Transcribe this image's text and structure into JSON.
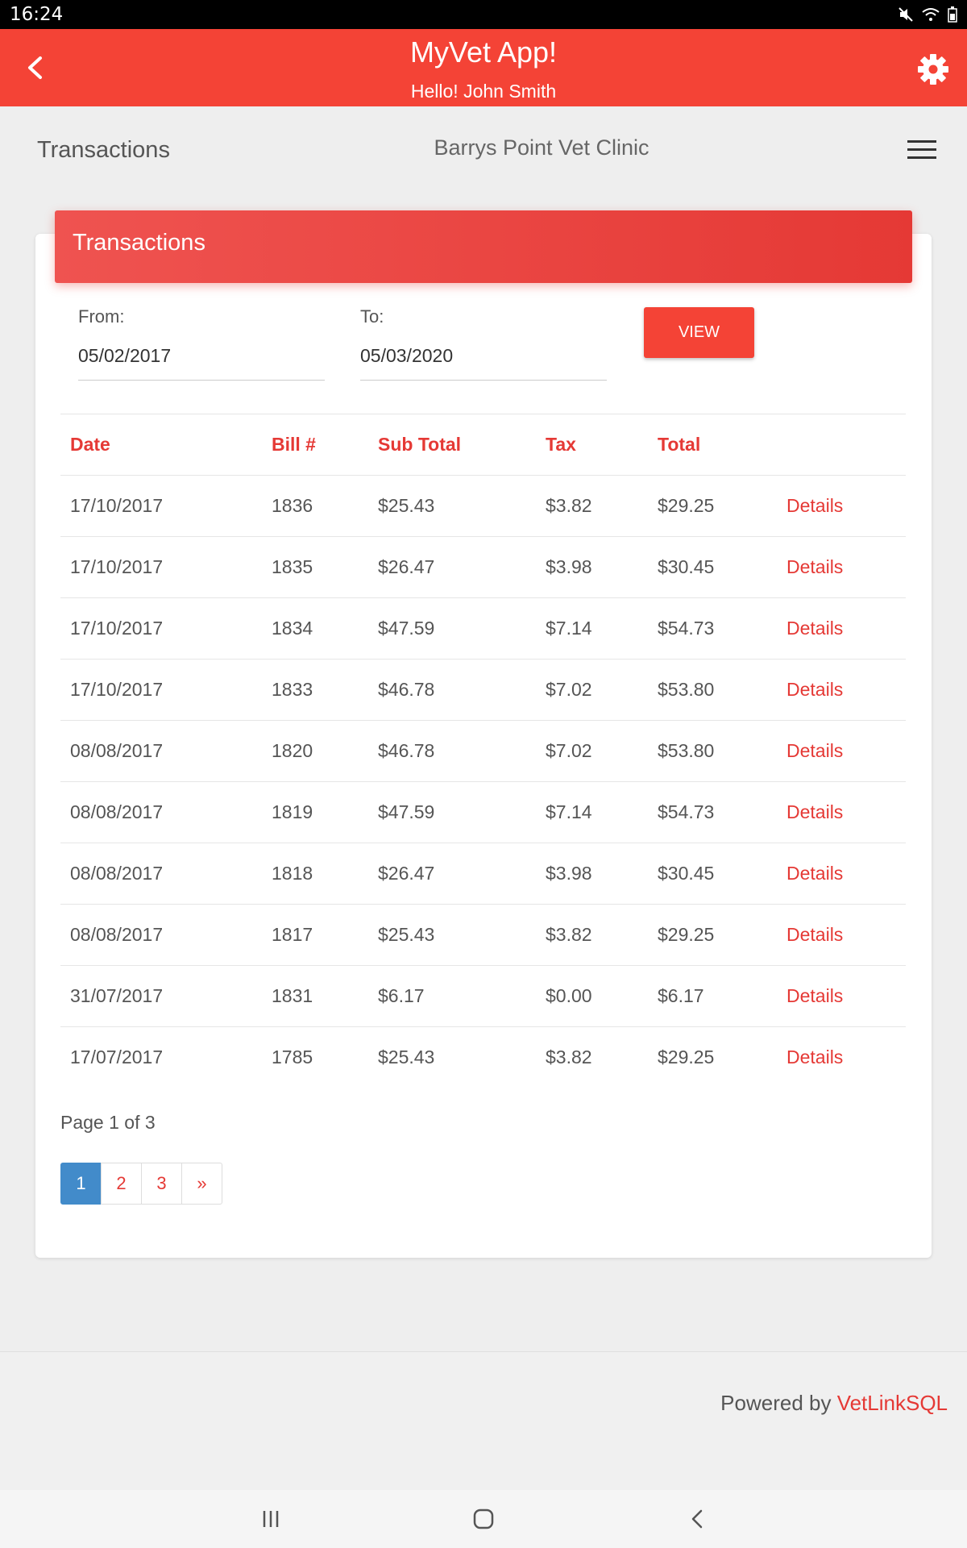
{
  "status_bar": {
    "time": "16:24",
    "icons": [
      "mute-icon",
      "wifi-icon",
      "battery-icon"
    ]
  },
  "app_bar": {
    "title": "MyVet App!",
    "subtitle": "Hello! John Smith"
  },
  "sub_header": {
    "page_title": "Transactions",
    "clinic": "Barrys Point Vet Clinic"
  },
  "card": {
    "title": "Transactions",
    "from_label": "From:",
    "from_value": "05/02/2017",
    "to_label": "To:",
    "to_value": "05/03/2020",
    "view_button": "VIEW"
  },
  "table": {
    "headers": [
      "Date",
      "Bill #",
      "Sub Total",
      "Tax",
      "Total",
      ""
    ],
    "rows": [
      [
        "17/10/2017",
        "1836",
        "$25.43",
        "$3.82",
        "$29.25",
        "Details"
      ],
      [
        "17/10/2017",
        "1835",
        "$26.47",
        "$3.98",
        "$30.45",
        "Details"
      ],
      [
        "17/10/2017",
        "1834",
        "$47.59",
        "$7.14",
        "$54.73",
        "Details"
      ],
      [
        "17/10/2017",
        "1833",
        "$46.78",
        "$7.02",
        "$53.80",
        "Details"
      ],
      [
        "08/08/2017",
        "1820",
        "$46.78",
        "$7.02",
        "$53.80",
        "Details"
      ],
      [
        "08/08/2017",
        "1819",
        "$47.59",
        "$7.14",
        "$54.73",
        "Details"
      ],
      [
        "08/08/2017",
        "1818",
        "$26.47",
        "$3.98",
        "$30.45",
        "Details"
      ],
      [
        "08/08/2017",
        "1817",
        "$25.43",
        "$3.82",
        "$29.25",
        "Details"
      ],
      [
        "31/07/2017",
        "1831",
        "$6.17",
        "$0.00",
        "$6.17",
        "Details"
      ],
      [
        "17/07/2017",
        "1785",
        "$25.43",
        "$3.82",
        "$29.25",
        "Details"
      ]
    ]
  },
  "pagination": {
    "info": "Page 1 of 3",
    "pages": [
      "1",
      "2",
      "3",
      "»"
    ],
    "active": "1"
  },
  "footer": {
    "powered_prefix": "Powered by ",
    "brand": "VetLinkSQL"
  },
  "colors": {
    "primary": "#f44336",
    "link": "#e53935",
    "pager_active": "#428bca"
  }
}
